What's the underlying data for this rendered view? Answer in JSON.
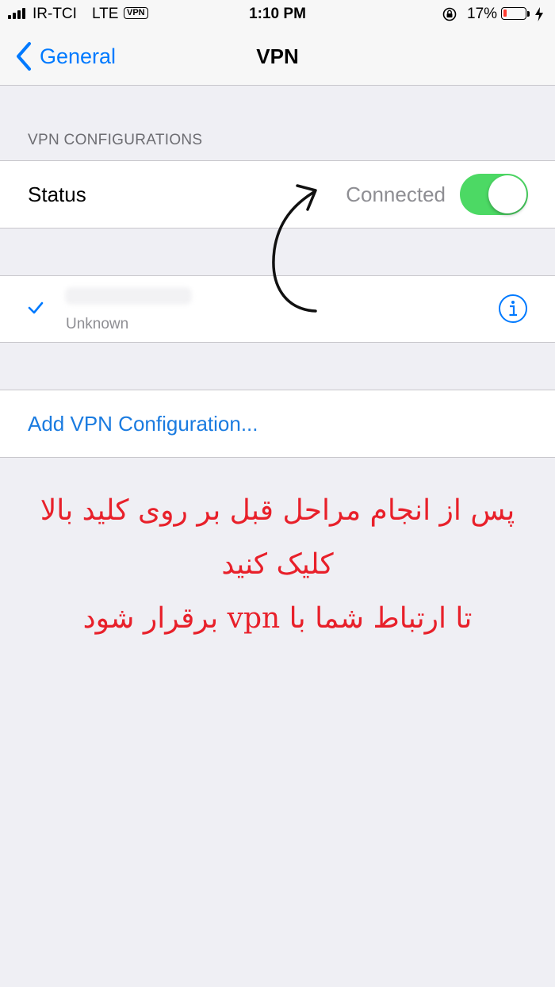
{
  "status_bar": {
    "carrier": "IR-TCI",
    "network": "LTE",
    "vpn_badge": "VPN",
    "time": "1:10 PM",
    "battery_percent": "17%",
    "battery_level": 0.17,
    "icons": [
      "signal-bars-icon",
      "rotation-lock-icon",
      "battery-icon",
      "charging-bolt-icon"
    ]
  },
  "nav": {
    "back_label": "General",
    "title": "VPN"
  },
  "section": {
    "header": "VPN CONFIGURATIONS"
  },
  "status_row": {
    "label": "Status",
    "value": "Connected",
    "toggle_on": true
  },
  "config_row": {
    "selected": true,
    "subtitle": "Unknown"
  },
  "add_row": {
    "label": "Add VPN Configuration..."
  },
  "annotation": {
    "lines": [
      "پس از انجام مراحل قبل بر روی کلید بالا",
      "کلیک کنید",
      "تا ارتباط شما با vpn برقرار شود"
    ]
  },
  "colors": {
    "accent": "#007aff",
    "toggle_on": "#4cd964",
    "annotation_text": "#e8202a",
    "background": "#efeff4",
    "battery_low": "#ff3b30"
  }
}
